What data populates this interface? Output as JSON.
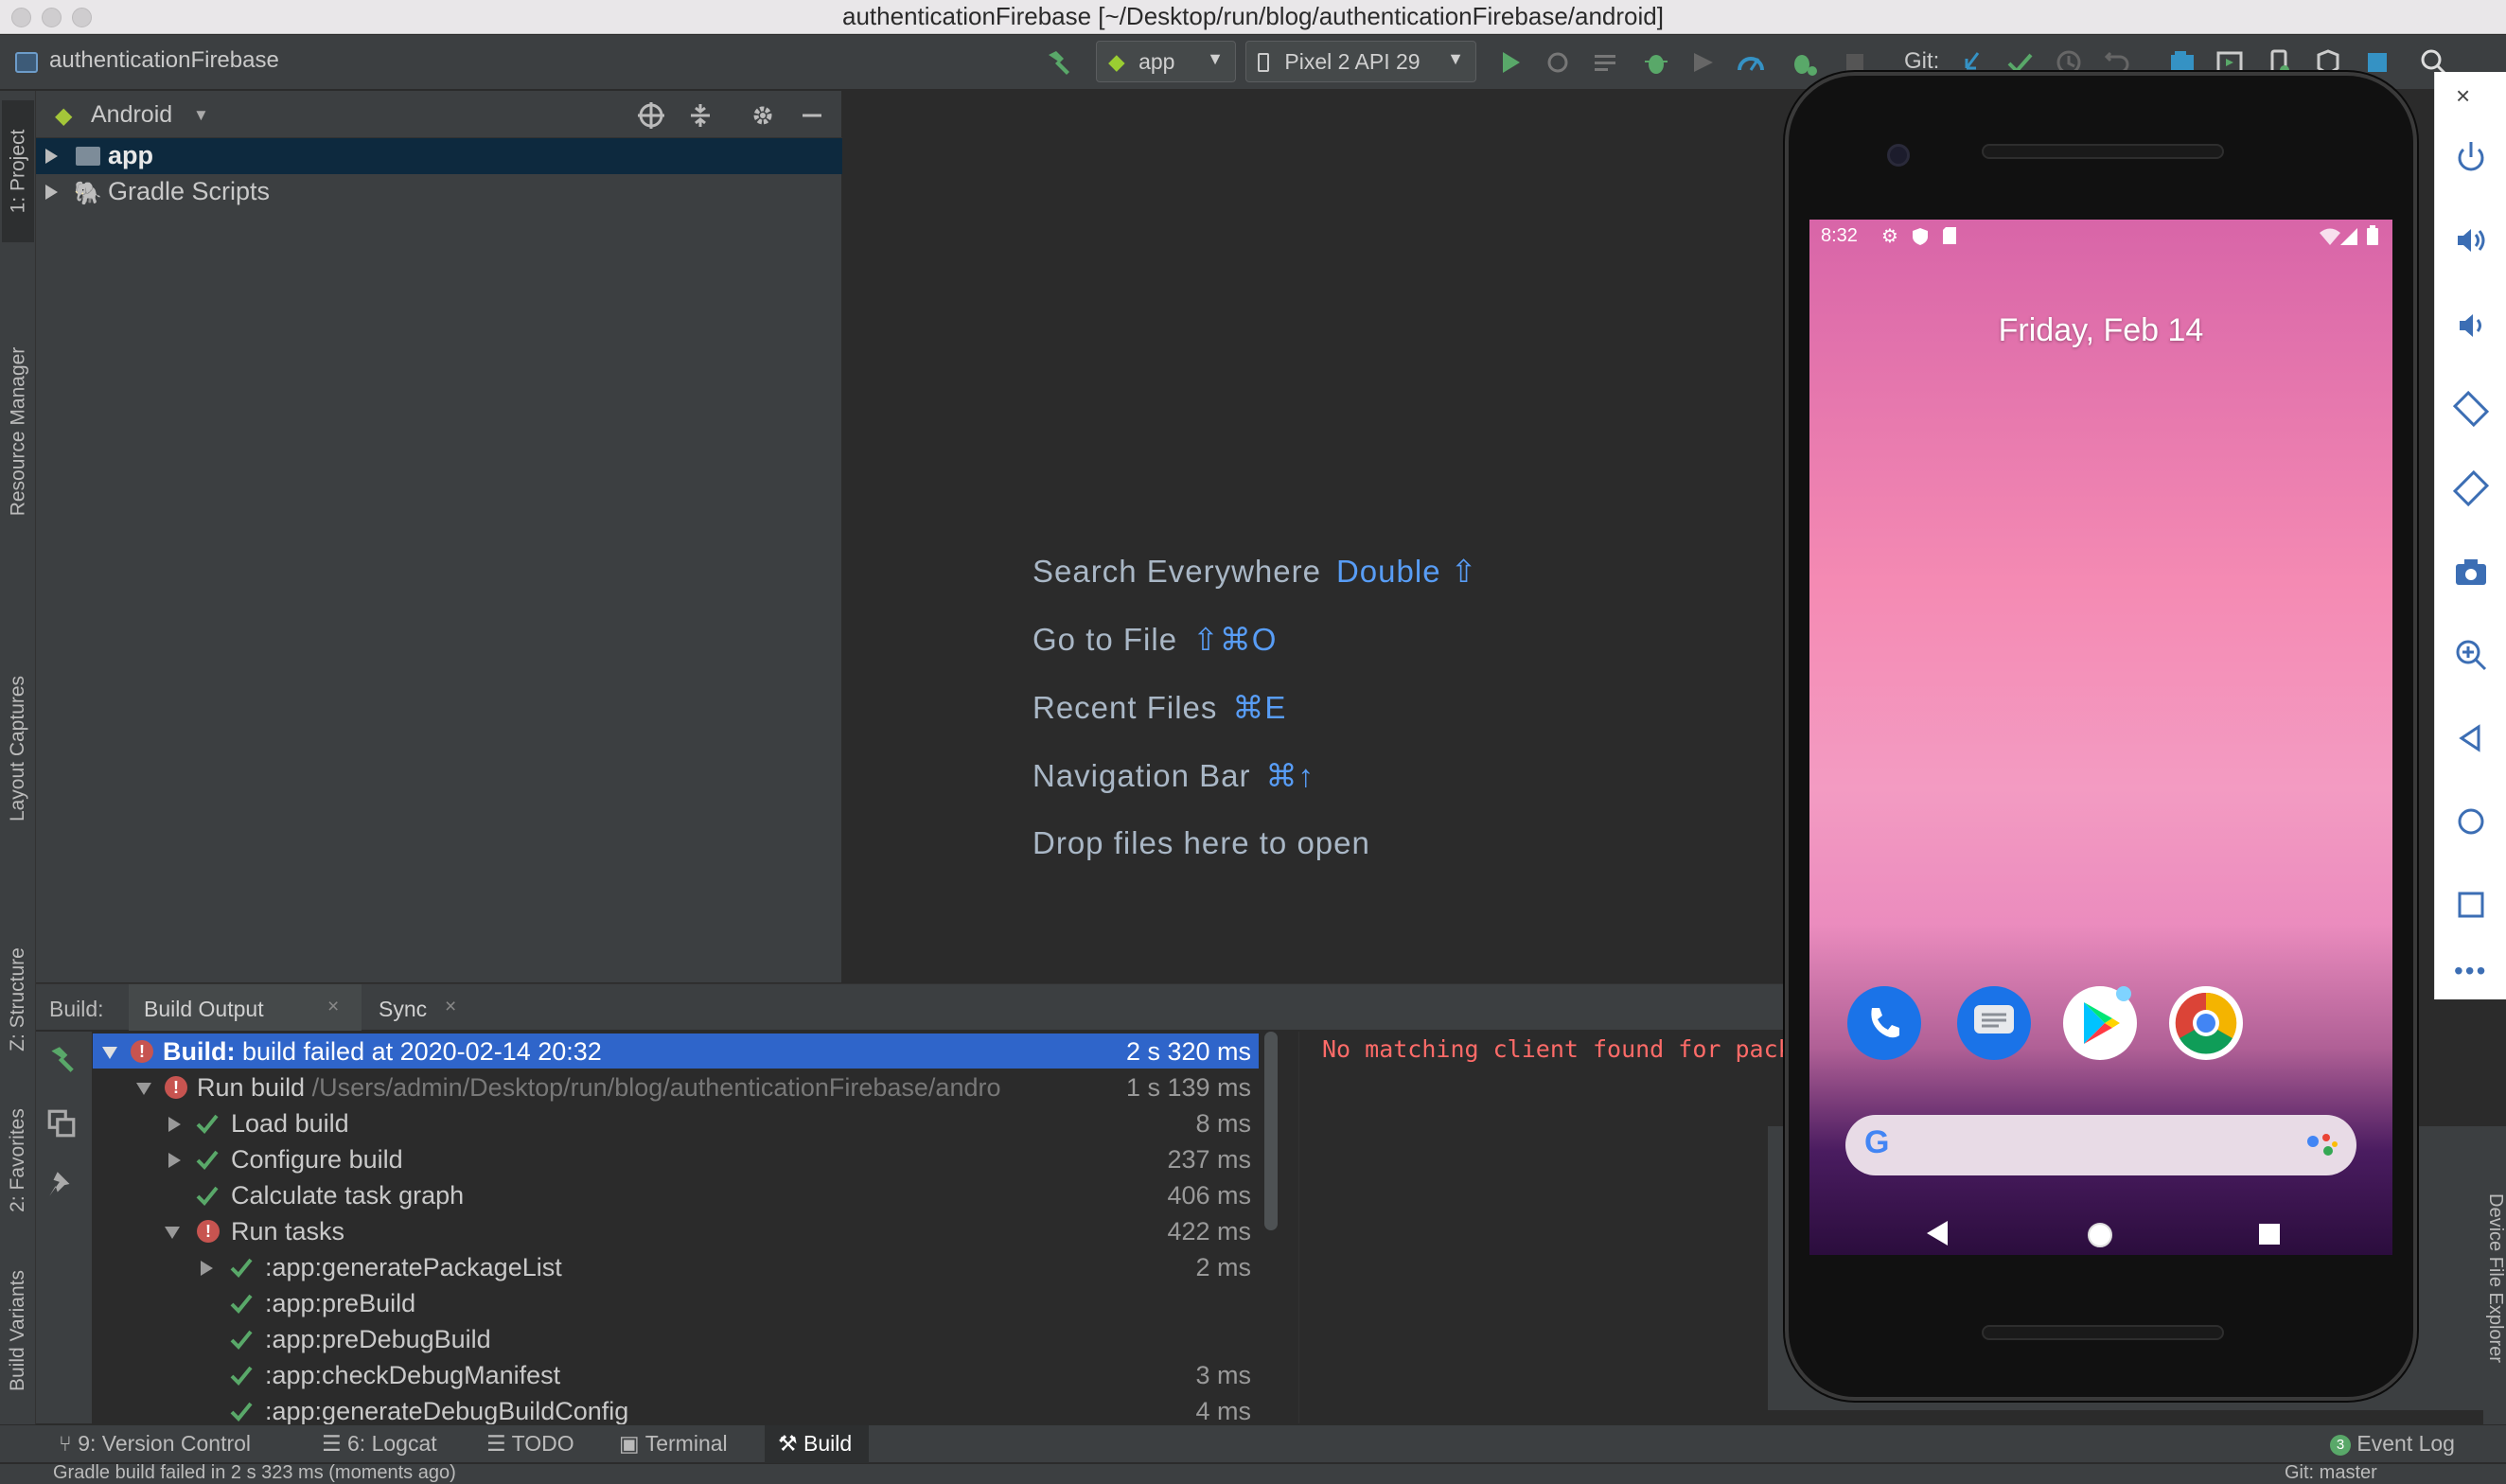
{
  "window": {
    "title": "authenticationFirebase [~/Desktop/run/blog/authenticationFirebase/android]"
  },
  "toolbar": {
    "project_name": "authenticationFirebase",
    "run_config": "app",
    "device": "Pixel 2 API 29",
    "git_label": "Git:"
  },
  "left_tabs": {
    "project": "1: Project",
    "resource_manager": "Resource Manager",
    "layout_captures": "Layout Captures",
    "structure": "Z: Structure",
    "favorites": "2: Favorites",
    "build_variants": "Build Variants"
  },
  "project_panel": {
    "view_mode": "Android",
    "tree": [
      {
        "label": "app",
        "selected": true
      },
      {
        "label": "Gradle Scripts",
        "selected": false
      }
    ]
  },
  "editor": {
    "hints": [
      {
        "label": "Search Everywhere",
        "shortcut": "Double ⇧"
      },
      {
        "label": "Go to File",
        "shortcut": "⇧⌘O"
      },
      {
        "label": "Recent Files",
        "shortcut": "⌘E"
      },
      {
        "label": "Navigation Bar",
        "shortcut": "⌘↑"
      },
      {
        "label": "Drop files here to open",
        "shortcut": ""
      }
    ]
  },
  "build": {
    "prefix": "Build:",
    "tabs": [
      {
        "label": "Build Output"
      },
      {
        "label": "Sync"
      }
    ],
    "rows": [
      {
        "bold": "Build:",
        "label": " build failed at 2020-02-14 20:32",
        "time": "2 s 320 ms"
      },
      {
        "label": "Run build",
        "path": " /Users/admin/Desktop/run/blog/authenticationFirebase/andro",
        "time": "1 s 139 ms"
      },
      {
        "label": "Load build",
        "time": "8 ms"
      },
      {
        "label": "Configure build",
        "time": "237 ms"
      },
      {
        "label": "Calculate task graph",
        "time": "406 ms"
      },
      {
        "label": "Run tasks",
        "time": "422 ms"
      },
      {
        "label": ":app:generatePackageList",
        "time": "2 ms"
      },
      {
        "label": ":app:preBuild",
        "time": ""
      },
      {
        "label": ":app:preDebugBuild",
        "time": ""
      },
      {
        "label": ":app:checkDebugManifest",
        "time": "3 ms"
      },
      {
        "label": ":app:generateDebugBuildConfig",
        "time": "4 ms"
      }
    ],
    "console_text": "No matching client found for packag"
  },
  "bottom_tabs": {
    "version_control": "9: Version Control",
    "logcat": "6: Logcat",
    "todo": "TODO",
    "terminal": "Terminal",
    "build": "Build",
    "event_log_count": "3",
    "event_log": "Event Log"
  },
  "status": {
    "message": "Gradle build failed in 2 s 323 ms (moments ago)",
    "git": "Git: master"
  },
  "emulator": {
    "time": "8:32",
    "date": "Friday, Feb 14",
    "right_tab": "Device File Explorer"
  },
  "colors": {
    "accent": "#589df6",
    "selection": "#2f65ca",
    "error": "#c75450",
    "success": "#59a869",
    "console_error": "#ff6b68"
  }
}
